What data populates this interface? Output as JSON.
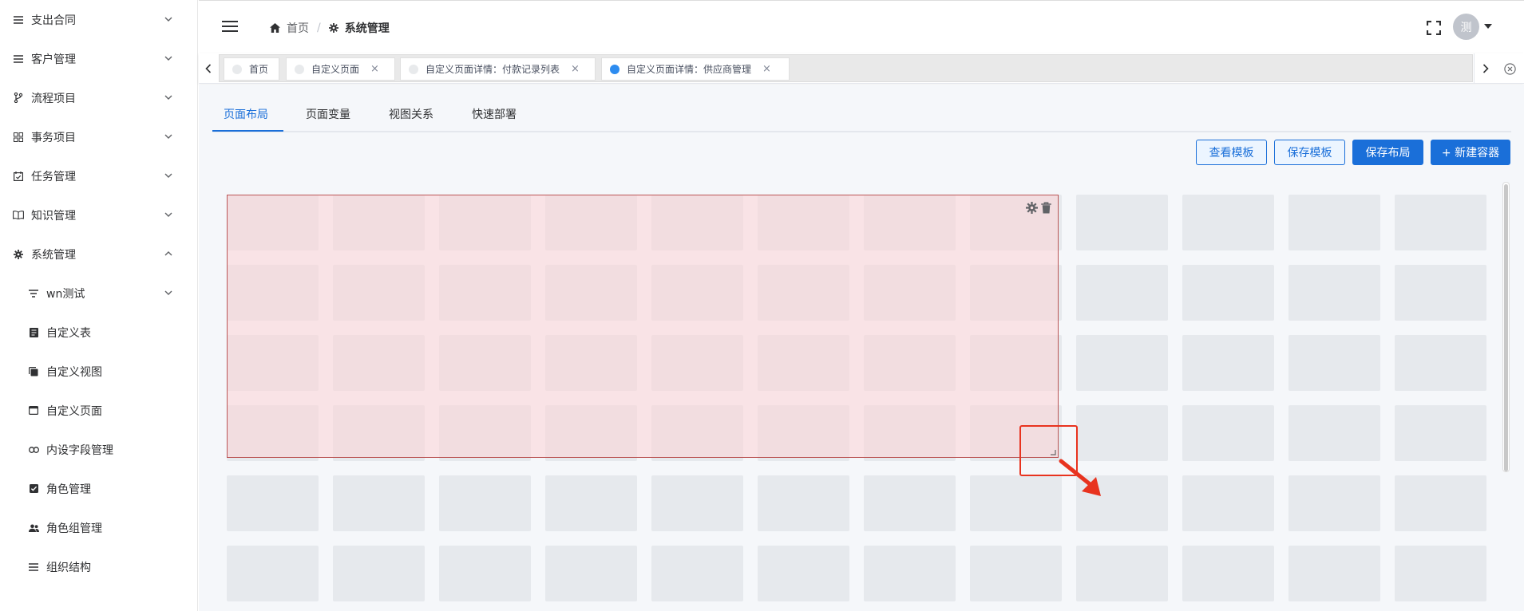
{
  "sidebar": {
    "items": [
      {
        "label": "支出合同",
        "icon": "list-icon"
      },
      {
        "label": "客户管理",
        "icon": "list-icon"
      },
      {
        "label": "流程项目",
        "icon": "branch-icon"
      },
      {
        "label": "事务项目",
        "icon": "grid-icon"
      },
      {
        "label": "任务管理",
        "icon": "calendar-check-icon"
      },
      {
        "label": "知识管理",
        "icon": "book-icon"
      },
      {
        "label": "系统管理",
        "icon": "gear-icon",
        "expanded": true
      }
    ],
    "subitems": [
      {
        "label": "wn测试",
        "icon": "filter-icon"
      },
      {
        "label": "自定义表",
        "icon": "form-icon"
      },
      {
        "label": "自定义视图",
        "icon": "copy-icon"
      },
      {
        "label": "自定义页面",
        "icon": "window-icon"
      },
      {
        "label": "内设字段管理",
        "icon": "link-icon"
      },
      {
        "label": "角色管理",
        "icon": "checkbox-icon"
      },
      {
        "label": "角色组管理",
        "icon": "group-icon"
      },
      {
        "label": "组织结构",
        "icon": "list-icon"
      }
    ]
  },
  "header": {
    "breadcrumb_home": "首页",
    "breadcrumb_sep": "/",
    "breadcrumb_current": "系统管理",
    "avatar_text": "测"
  },
  "tags": [
    {
      "label": "首页",
      "closable": false,
      "active": false
    },
    {
      "label": "自定义页面",
      "closable": true,
      "active": false
    },
    {
      "label": "自定义页面详情：付款记录列表",
      "closable": true,
      "active": false
    },
    {
      "label": "自定义页面详情：供应商管理",
      "closable": true,
      "active": true
    }
  ],
  "tag_close_glyph": "×",
  "tabs": [
    {
      "label": "页面布局",
      "active": true
    },
    {
      "label": "页面变量"
    },
    {
      "label": "视图关系"
    },
    {
      "label": "快速部署"
    }
  ],
  "buttons": {
    "view_template": "查看模板",
    "save_template": "保存模板",
    "save_layout": "保存布局",
    "new_container": "+ 新建容器"
  },
  "colors": {
    "primary": "#1a6fd9",
    "container_fill": "#fbe0e1",
    "grid_cell": "#e6e9ed",
    "annotation": "#e8331f"
  }
}
